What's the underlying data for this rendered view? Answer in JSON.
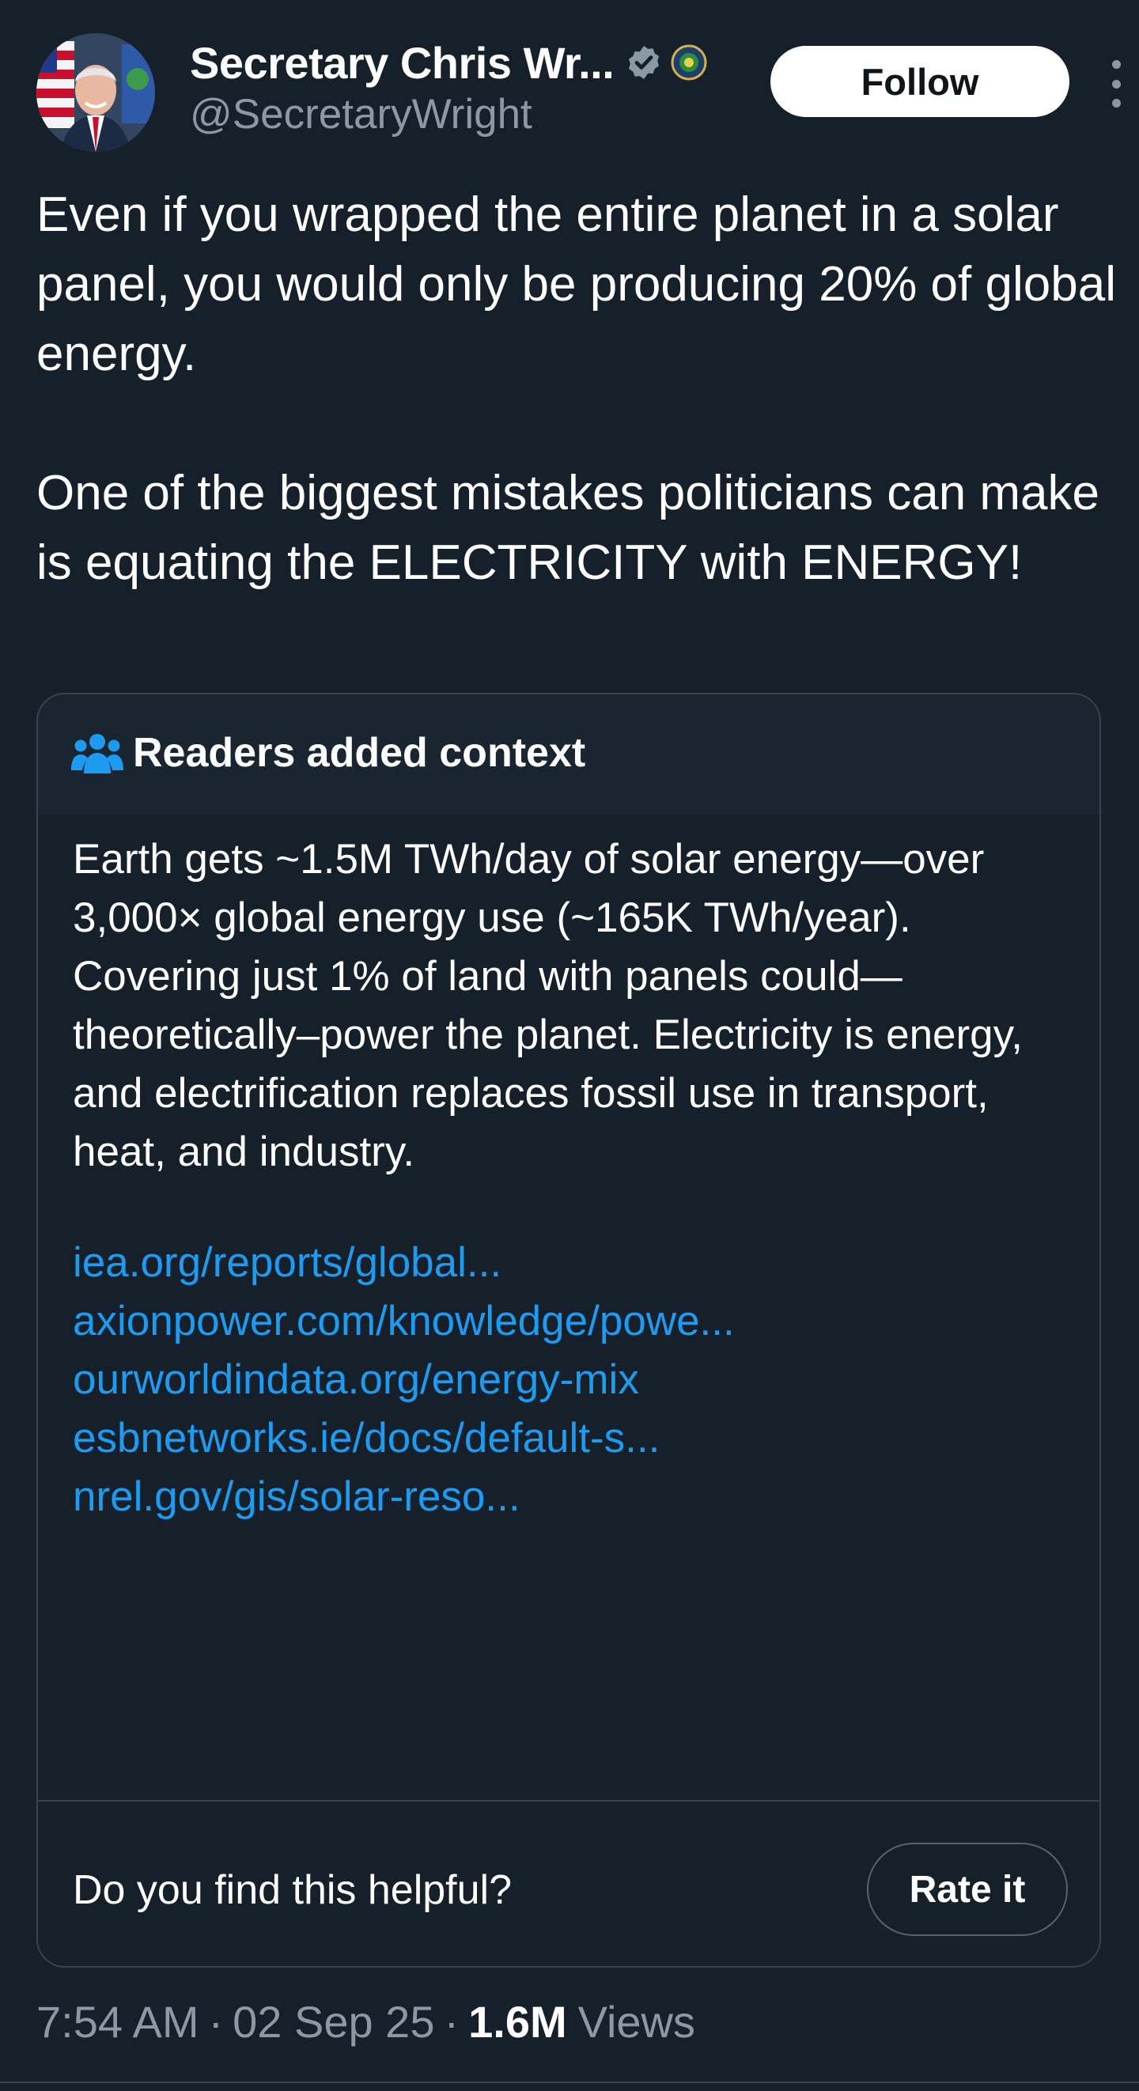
{
  "author": {
    "display_name": "Secretary Chris Wr...",
    "handle": "@SecretaryWright"
  },
  "actions": {
    "follow_label": "Follow"
  },
  "tweet": {
    "text": "Even if you wrapped the entire planet in a solar panel, you would only be producing 20% of global energy.\n\nOne of the biggest mistakes politicians can make is equating the ELECTRICITY with ENERGY!"
  },
  "note": {
    "title": "Readers added context",
    "body": "Earth gets ~1.5M TWh/day of solar energy—over 3,000× global energy use (~165K TWh/year). Covering just 1% of land with panels could—theoretically–power the planet. Electricity is energy, and electrification replaces fossil use in transport, heat, and industry.",
    "links": [
      "iea.org/reports/global...",
      "axionpower.com/knowledge/powe...",
      "ourworldindata.org/energy-mix",
      "esbnetworks.ie/docs/default-s...",
      "nrel.gov/gis/solar-reso..."
    ],
    "helpful_question": "Do you find this helpful?",
    "rate_label": "Rate it"
  },
  "meta": {
    "time": "7:54 AM",
    "date": "02 Sep 25",
    "views_count": "1.6M",
    "views_label": "Views",
    "separator": "·"
  },
  "colors": {
    "background": "#15202b",
    "link": "#1d9bf0",
    "secondary_text": "#8b98a5",
    "verified_badge": "#8b98a5"
  },
  "icons": {
    "verified": "verified-badge-icon",
    "affiliation": "doe-seal-icon",
    "more": "more-dots-icon",
    "note_header": "people-group-icon"
  }
}
